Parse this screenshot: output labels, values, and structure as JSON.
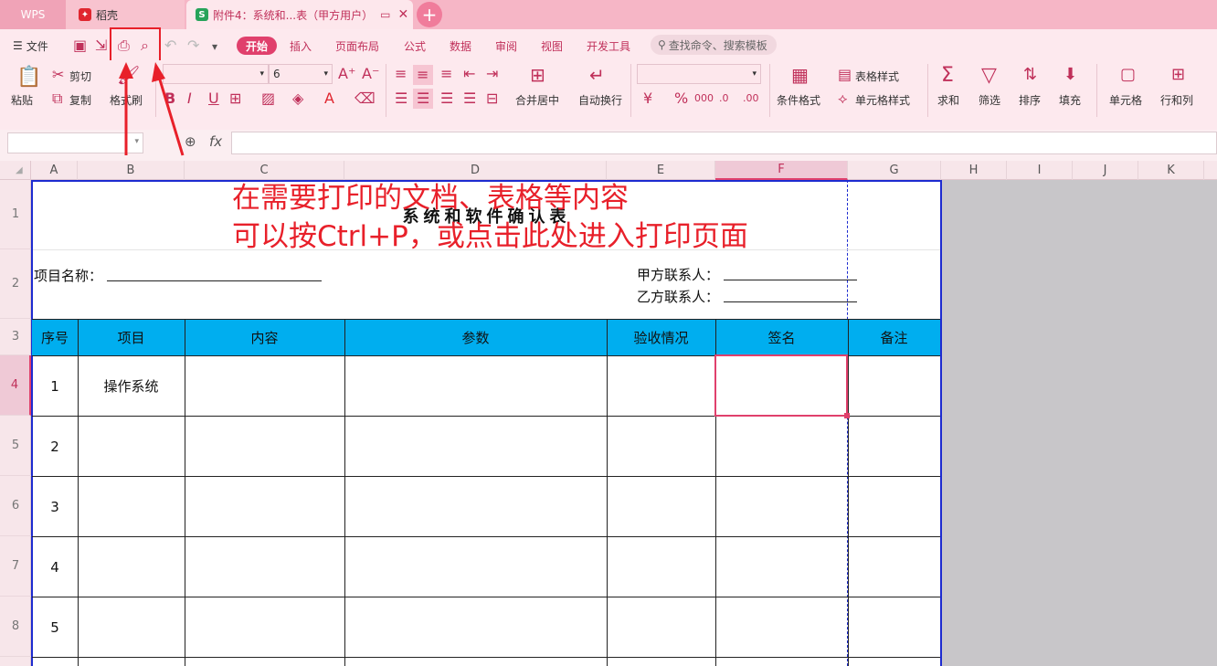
{
  "tabs": {
    "wps": "WPS",
    "daoke": "稻壳",
    "doc": "附件4：系统和...表（甲方用户）"
  },
  "menu": {
    "file": "文件"
  },
  "ribbon_tabs": [
    "开始",
    "插入",
    "页面布局",
    "公式",
    "数据",
    "审阅",
    "视图",
    "开发工具"
  ],
  "search": {
    "placeholder": "查找命令、搜索模板"
  },
  "toolbar": {
    "paste": "粘贴",
    "cut": "剪切",
    "copy": "复制",
    "format_painter": "格式刷",
    "font_size": "6",
    "merge": "合并居中",
    "wrap": "自动换行",
    "cond_format": "条件格式",
    "table_style": "表格样式",
    "cell_style": "单元格样式",
    "sum": "求和",
    "filter": "筛选",
    "sort": "排序",
    "fill": "填充",
    "cell": "单元格",
    "row_col": "行和列"
  },
  "formula": {
    "fx": "fx"
  },
  "columns": [
    "A",
    "B",
    "C",
    "D",
    "E",
    "F",
    "G",
    "H",
    "I",
    "J",
    "K"
  ],
  "rows": [
    "1",
    "2",
    "3",
    "4",
    "5",
    "6",
    "7",
    "8"
  ],
  "sheet": {
    "title": "系统和软件确认表",
    "project_label": "项目名称：",
    "contact_a": "甲方联系人：",
    "contact_b": "乙方联系人：",
    "headers": [
      "序号",
      "项目",
      "内容",
      "参数",
      "验收情况",
      "签名",
      "备注"
    ],
    "data_rows": [
      {
        "no": "1",
        "item": "操作系统"
      },
      {
        "no": "2",
        "item": ""
      },
      {
        "no": "3",
        "item": ""
      },
      {
        "no": "4",
        "item": ""
      },
      {
        "no": "5",
        "item": ""
      }
    ]
  },
  "annotation": {
    "line1": "在需要打印的文档、表格等内容",
    "line2": "可以按Ctrl+P，或点击此处进入打印页面"
  },
  "colors": {
    "accent": "#e0406c",
    "header_fill": "#00aeef",
    "annotation": "#e8202a"
  }
}
